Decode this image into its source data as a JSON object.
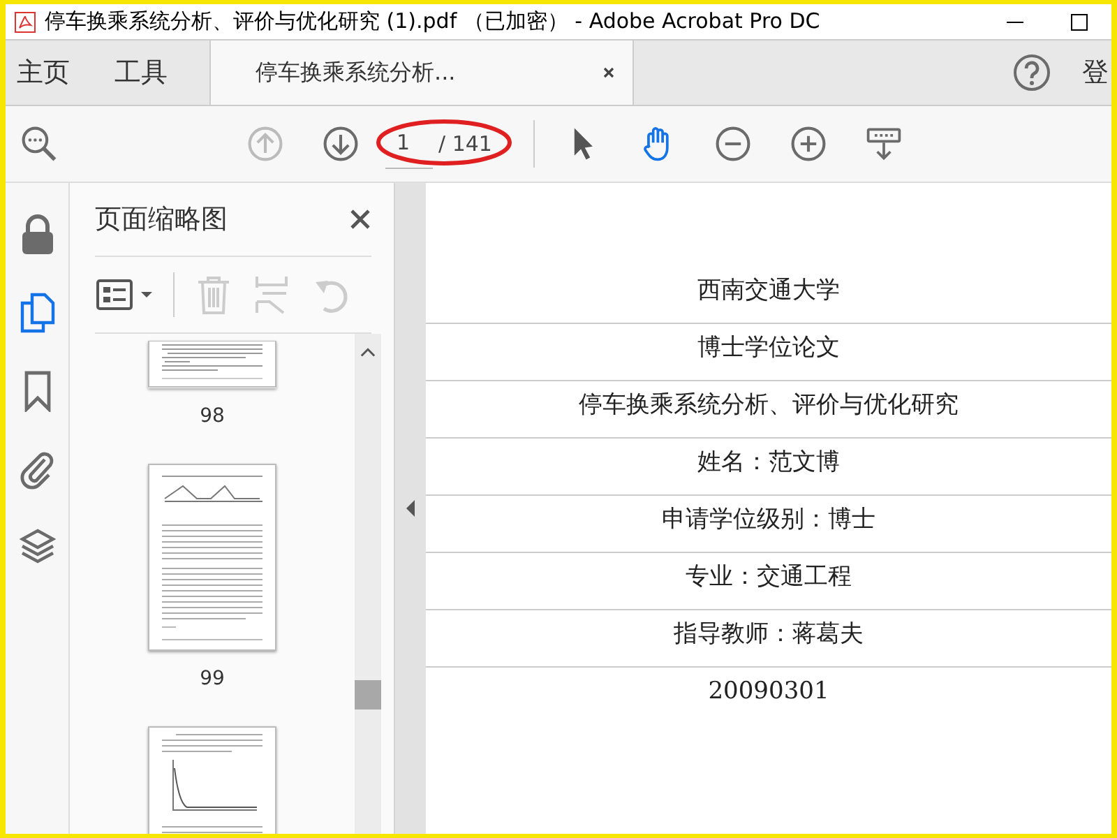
{
  "window": {
    "title": "停车换乘系统分析、评价与优化研究 (1).pdf （已加密） - Adobe Acrobat Pro DC"
  },
  "tabs": [
    {
      "label": "主页",
      "selected": false
    },
    {
      "label": "工具",
      "selected": false
    },
    {
      "label": "停车换乘系统分析...",
      "selected": true
    }
  ],
  "account": {
    "label": "登"
  },
  "toolbar": {
    "page_current": "1",
    "page_total": "/ 141",
    "page_circled": true,
    "tools": [
      {
        "kind": "select",
        "selected": false
      },
      {
        "kind": "hand",
        "selected": true
      },
      {
        "kind": "zoom-out",
        "selected": false
      },
      {
        "kind": "zoom-in",
        "selected": false
      },
      {
        "kind": "fit",
        "selected": false
      }
    ]
  },
  "rail": [
    {
      "kind": "lock",
      "selected": false
    },
    {
      "kind": "pages",
      "selected": true
    },
    {
      "kind": "bookmark",
      "selected": false
    },
    {
      "kind": "attachment",
      "selected": false
    },
    {
      "kind": "layers",
      "selected": false
    }
  ],
  "panel": {
    "title": "页面缩略图",
    "thumbnails": [
      {
        "kind": "text-end",
        "label": "98"
      },
      {
        "kind": "figure-table",
        "label": "99"
      },
      {
        "kind": "chart"
      }
    ]
  },
  "document": {
    "lines": [
      {
        "text": "西南交通大学",
        "underlined": true
      },
      {
        "text": "博士学位论文",
        "underlined": true
      },
      {
        "text": "停车换乘系统分析、评价与优化研究",
        "underlined": true
      },
      {
        "text": "姓名：范文博",
        "underlined": true
      },
      {
        "text": "申请学位级别：博士",
        "underlined": true
      },
      {
        "text": "专业：交通工程",
        "underlined": true
      },
      {
        "text": "指导教师：蒋葛夫",
        "underlined": true
      },
      {
        "text": "20090301",
        "underlined": false
      }
    ]
  }
}
